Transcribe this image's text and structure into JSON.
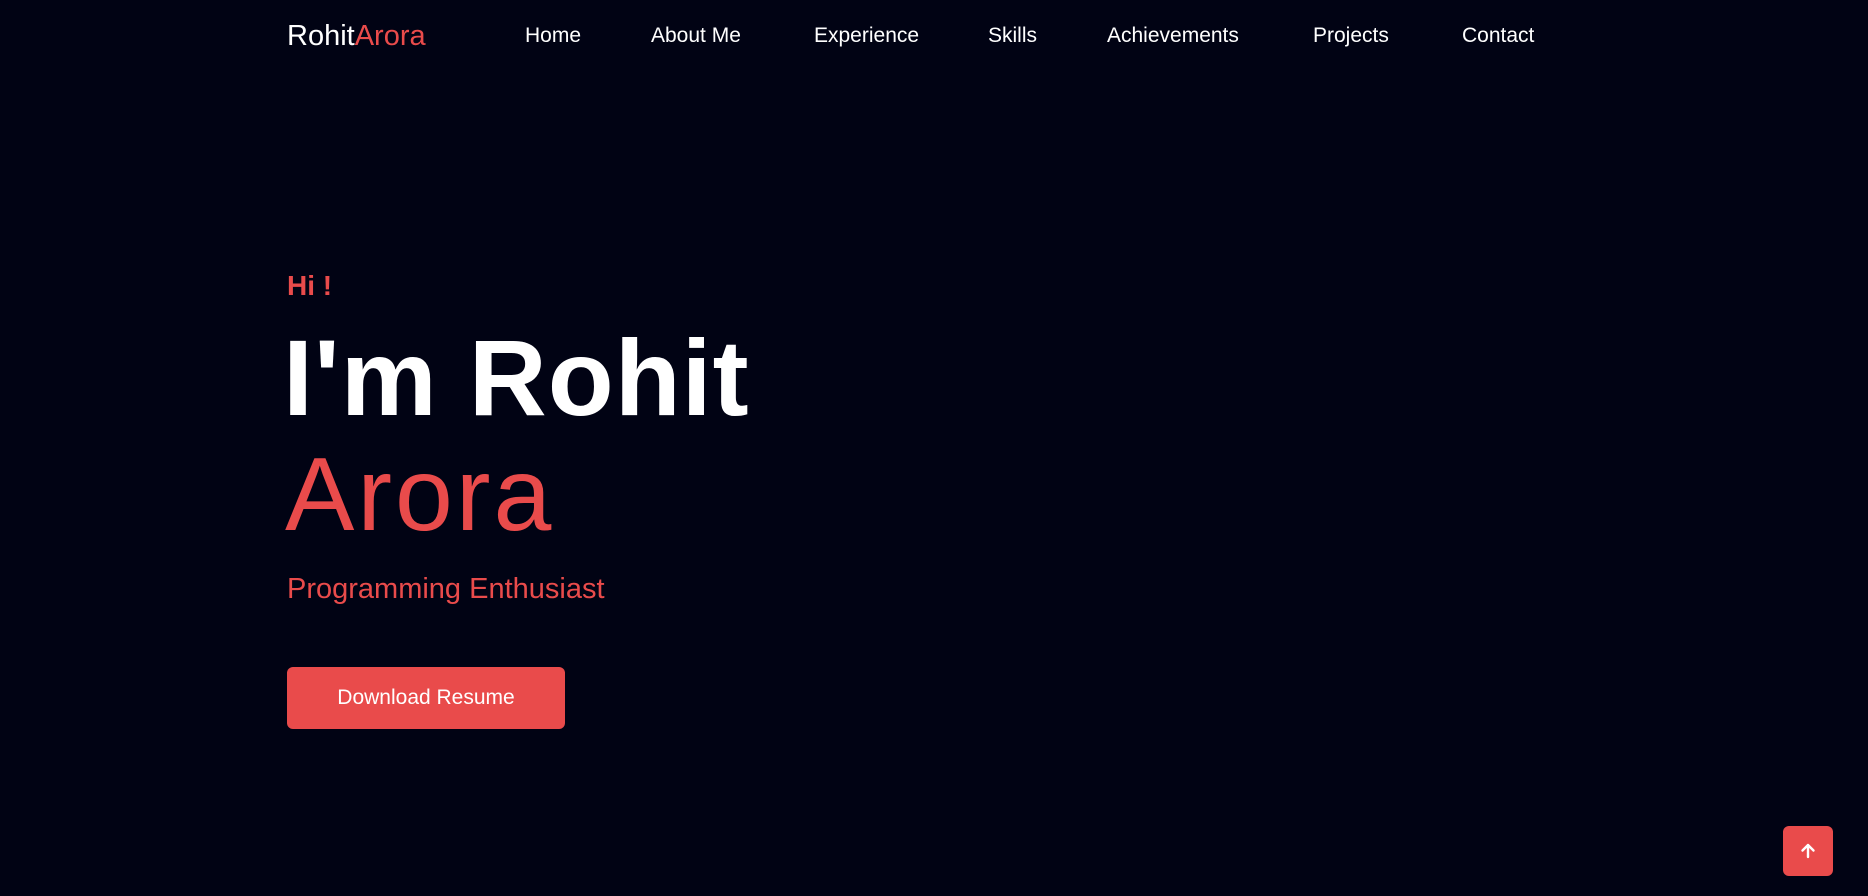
{
  "brand": {
    "first": "Rohit",
    "last": "Arora"
  },
  "nav": {
    "items": [
      {
        "label": "Home"
      },
      {
        "label": "About Me"
      },
      {
        "label": "Experience"
      },
      {
        "label": "Skills"
      },
      {
        "label": "Achievements"
      },
      {
        "label": "Projects"
      },
      {
        "label": "Contact"
      }
    ]
  },
  "hero": {
    "greeting": "Hi !",
    "name_line1": "I'm Rohit",
    "name_line2": "Arora",
    "role": "Programming Enthusiast",
    "cta_label": "Download Resume"
  },
  "scroll_top": {
    "icon": "arrow-up-icon"
  },
  "colors": {
    "background": "#010314",
    "accent": "#e94b4b",
    "text": "#ffffff"
  }
}
